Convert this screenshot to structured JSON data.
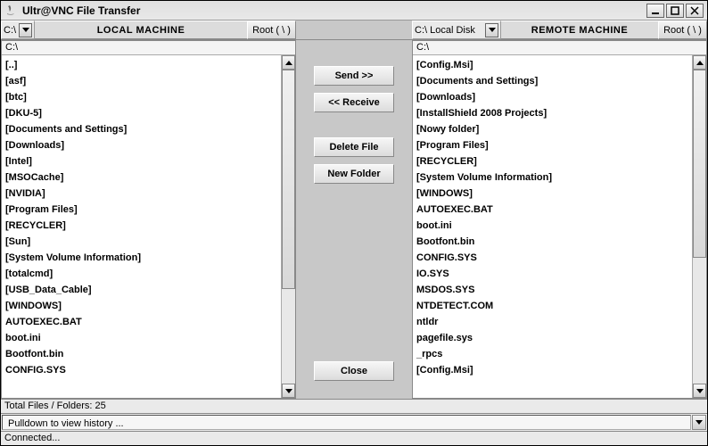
{
  "window": {
    "title": "Ultr@VNC File Transfer"
  },
  "local": {
    "drive": "C:\\",
    "header": "LOCAL MACHINE",
    "root_button": "Root ( \\ )",
    "path": "C:\\",
    "items": [
      "[..]",
      "[asf]",
      "[btc]",
      "[DKU-5]",
      "[Documents and Settings]",
      "[Downloads]",
      "[Intel]",
      "[MSOCache]",
      "[NVIDIA]",
      "[Program Files]",
      "[RECYCLER]",
      "[Sun]",
      "[System Volume Information]",
      "[totalcmd]",
      "[USB_Data_Cable]",
      "[WINDOWS]",
      "AUTOEXEC.BAT",
      "boot.ini",
      "Bootfont.bin",
      "CONFIG.SYS"
    ]
  },
  "remote": {
    "drive": "C:\\ Local Disk",
    "header": "REMOTE MACHINE",
    "root_button": "Root ( \\ )",
    "path": "C:\\",
    "items": [
      "[Config.Msi]",
      "[Documents and Settings]",
      "[Downloads]",
      "[InstallShield 2008 Projects]",
      "[Nowy folder]",
      "[Program Files]",
      "[RECYCLER]",
      "[System Volume Information]",
      "[WINDOWS]",
      "AUTOEXEC.BAT",
      "boot.ini",
      "Bootfont.bin",
      "CONFIG.SYS",
      "IO.SYS",
      "MSDOS.SYS",
      "NTDETECT.COM",
      "ntldr",
      "pagefile.sys",
      "_rpcs",
      "[Config.Msi]"
    ]
  },
  "actions": {
    "send": "Send >>",
    "receive": "<< Receive",
    "delete": "Delete File",
    "new_folder": "New Folder",
    "close": "Close"
  },
  "status": {
    "total": "Total Files / Folders: 25"
  },
  "history": {
    "placeholder": "Pulldown to view history ..."
  },
  "connection": {
    "status": "Connected..."
  }
}
